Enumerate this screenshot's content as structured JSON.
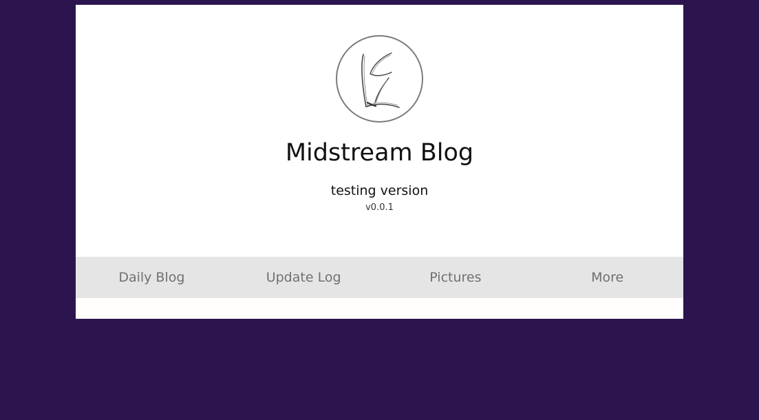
{
  "blog": {
    "title": "Midstream Blog",
    "subtitle": "testing version",
    "version": "v0.0.1"
  },
  "nav": {
    "items": [
      {
        "label": "Daily Blog"
      },
      {
        "label": "Update Log"
      },
      {
        "label": "Pictures"
      },
      {
        "label": "More"
      }
    ]
  },
  "colors": {
    "background": "#2c154e",
    "card": "#ffffff",
    "nav_bar": "#e6e5e6",
    "nav_text": "#707070"
  },
  "icons": {
    "logo": "handwritten-logo-icon"
  }
}
